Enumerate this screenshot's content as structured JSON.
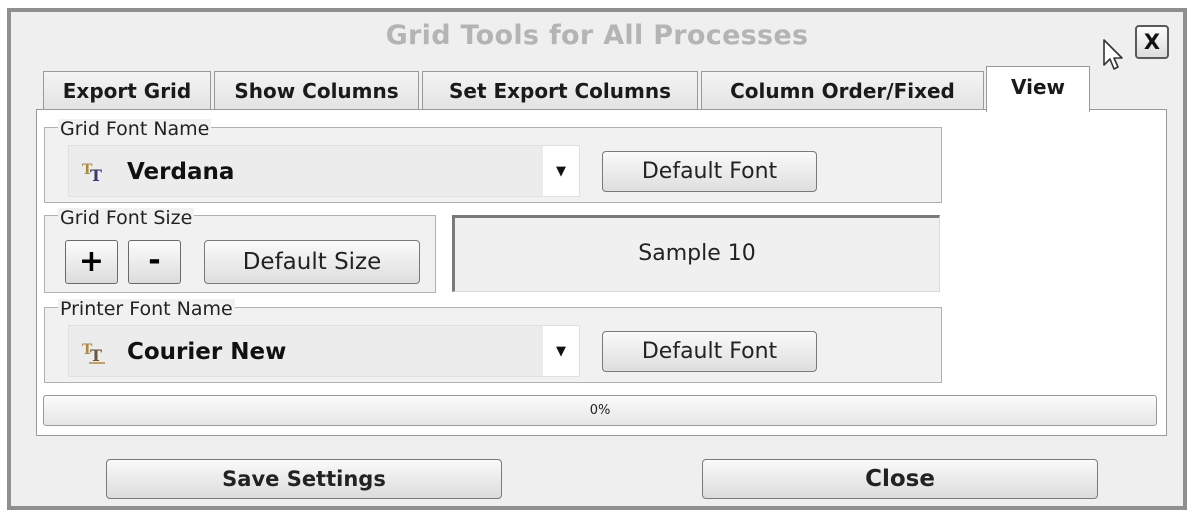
{
  "dialog": {
    "title": "Grid Tools for All Processes",
    "close_glyph": "X"
  },
  "tabs": [
    {
      "label": "Export Grid",
      "active": false
    },
    {
      "label": "Show Columns",
      "active": false
    },
    {
      "label": "Set Export Columns",
      "active": false
    },
    {
      "label": "Column Order/Fixed",
      "active": false
    },
    {
      "label": "View",
      "active": true
    }
  ],
  "grid_font_name": {
    "legend": "Grid Font Name",
    "value": "Verdana",
    "icon": "truetype-font-icon",
    "default_button": "Default Font"
  },
  "grid_font_size": {
    "legend": "Grid Font Size",
    "increase_label": "+",
    "decrease_label": "-",
    "default_button": "Default Size"
  },
  "sample": {
    "text": "Sample 10"
  },
  "printer_font_name": {
    "legend": "Printer Font Name",
    "value": "Courier New",
    "icon": "truetype-font-icon",
    "default_button": "Default Font"
  },
  "progress": {
    "value": 0,
    "label": "0%"
  },
  "footer": {
    "save_label": "Save Settings",
    "close_label": "Close"
  },
  "colors": {
    "frame": "#8f8f8f",
    "title": "#b4b4b4",
    "background": "#efefef"
  }
}
